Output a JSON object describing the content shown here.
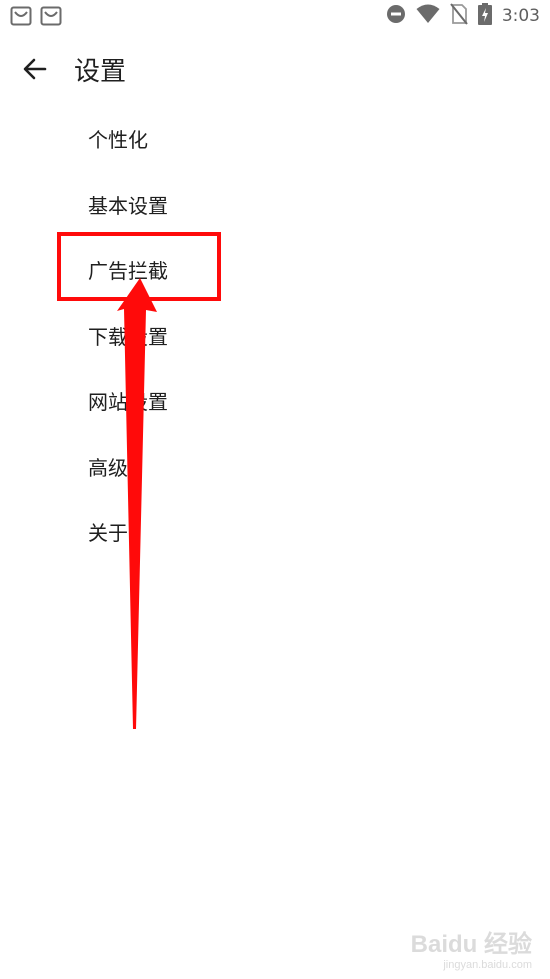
{
  "status_bar": {
    "time": "3:03",
    "left_icons": [
      "app-notification-icon",
      "app-notification-icon"
    ],
    "right_icons": [
      "do-not-disturb-icon",
      "wifi-icon",
      "no-sim-icon",
      "battery-charging-icon"
    ]
  },
  "app_bar": {
    "back_icon": "arrow-left-icon",
    "title": "设置"
  },
  "settings": {
    "items": [
      {
        "label": "个性化"
      },
      {
        "label": "基本设置"
      },
      {
        "label": "广告拦截"
      },
      {
        "label": "下载设置"
      },
      {
        "label": "网站设置"
      },
      {
        "label": "高级"
      },
      {
        "label": "关于"
      }
    ]
  },
  "annotation": {
    "highlighted_item": "广告拦截",
    "color": "#ff0a0a"
  },
  "watermark": {
    "brand": "Baidu 经验",
    "url": "jingyan.baidu.com"
  }
}
